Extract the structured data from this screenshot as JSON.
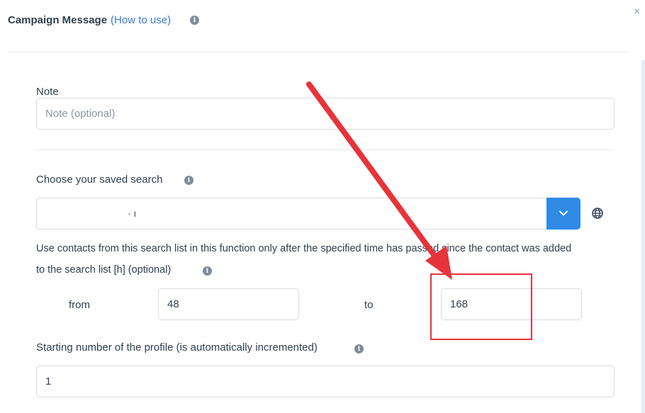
{
  "header": {
    "title": "Campaign Message",
    "how_to_use": "(How to use)",
    "info_icon_glyph": "i",
    "close_glyph": "×"
  },
  "note": {
    "label": "Note",
    "placeholder": "Note (optional)"
  },
  "saved_search": {
    "label": "Choose your saved search",
    "selected_value": "· ı"
  },
  "time_filter": {
    "description_line1": "Use contacts from this search list in this function only after the specified time has passed since the contact was added",
    "description_line2": "to the search list [h] (optional)",
    "from_label": "from",
    "from_value": "48",
    "to_label": "to",
    "to_value": "168"
  },
  "starting_number": {
    "label": "Starting number of the profile (is automatically incremented)",
    "value": "1"
  },
  "colors": {
    "accent": "#2f8ae5",
    "annotation": "#e8333a"
  }
}
